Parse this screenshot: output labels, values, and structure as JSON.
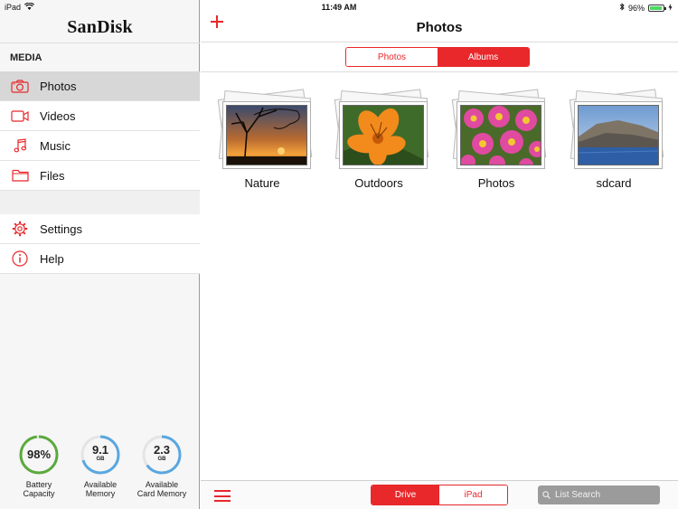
{
  "status": {
    "device": "iPad",
    "time": "11:49 AM",
    "battery": "96%",
    "battery_level": 0.96
  },
  "colors": {
    "accent": "#e8282b",
    "battery_ring": "#5aaa3c",
    "memory_ring": "#59a7e0"
  },
  "sidebar": {
    "logo": "SanDisk",
    "section": "MEDIA",
    "items": [
      {
        "label": "Photos",
        "icon": "camera-icon",
        "active": true
      },
      {
        "label": "Videos",
        "icon": "video-camera-icon"
      },
      {
        "label": "Music",
        "icon": "music-note-icon"
      },
      {
        "label": "Files",
        "icon": "folder-icon"
      }
    ],
    "secondary": [
      {
        "label": "Settings",
        "icon": "gear-icon"
      },
      {
        "label": "Help",
        "icon": "info-icon"
      }
    ]
  },
  "gauges": [
    {
      "value": "98%",
      "unit": "",
      "label1": "Battery",
      "label2": "Capacity",
      "fill": 0.98
    },
    {
      "value": "9.1",
      "unit": "GB",
      "label1": "Available",
      "label2": "Memory",
      "fill": 0.7
    },
    {
      "value": "2.3",
      "unit": "GB",
      "label1": "Available",
      "label2": "Card Memory",
      "fill": 0.65
    }
  ],
  "header": {
    "title": "Photos"
  },
  "top_segment": {
    "options": [
      "Photos",
      "Albums"
    ],
    "selected": "Albums"
  },
  "albums": [
    {
      "label": "Nature",
      "icon": "sunset-tree-thumbnail"
    },
    {
      "label": "Outdoors",
      "icon": "orange-lily-thumbnail"
    },
    {
      "label": "Photos",
      "icon": "pink-flowers-thumbnail"
    },
    {
      "label": "sdcard",
      "icon": "mountain-lake-thumbnail"
    }
  ],
  "bottom_segment": {
    "options": [
      "Drive",
      "iPad"
    ],
    "selected": "Drive"
  },
  "search": {
    "placeholder": "List Search"
  }
}
